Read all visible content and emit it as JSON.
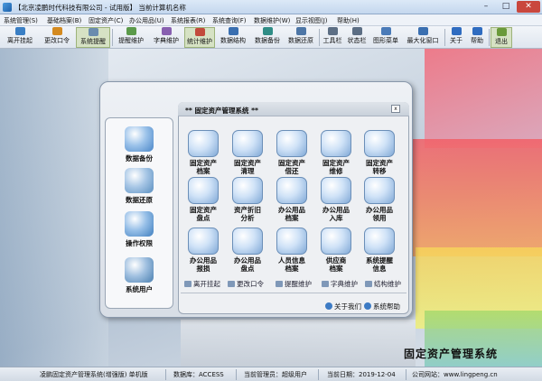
{
  "window": {
    "title": "【北京凌鹏时代科技有限公司 - 试用版】    当前计算机名称",
    "minimize": "–",
    "maximize": "□",
    "close": "✕"
  },
  "menu": [
    "系统管理(S)",
    "基础档案(B)",
    "固定资产(C)",
    "办公用品(U)",
    "系统报表(R)",
    "系统查询(F)",
    "数据维护(W)",
    "显示视图(J)",
    "帮助(H)"
  ],
  "toolbar": [
    {
      "label": "离开挂起",
      "icon": "pause-icon",
      "color": "#3a7fc4"
    },
    {
      "label": "更改口令",
      "icon": "key-icon",
      "color": "#d48a1f"
    },
    {
      "label": "系统提醒",
      "icon": "bell-icon",
      "color": "#6a8cae"
    },
    {
      "label": "提醒维护",
      "icon": "bell-edit-icon",
      "color": "#5b9a4a"
    },
    {
      "label": "字典维护",
      "icon": "book-icon",
      "color": "#8860b0"
    },
    {
      "label": "统计维护",
      "icon": "stats-icon",
      "color": "#c24a3b"
    },
    {
      "label": "数据结构",
      "icon": "database-icon",
      "color": "#3a6fb0"
    },
    {
      "label": "数据备份",
      "icon": "backup-icon",
      "color": "#2f8d86"
    },
    {
      "label": "数据还原",
      "icon": "restore-icon",
      "color": "#4d76a6"
    },
    {
      "label": "工具栏",
      "icon": "toolbar-icon",
      "color": "#5c6e84"
    },
    {
      "label": "状态栏",
      "icon": "statusbar-icon",
      "color": "#5c6e84"
    },
    {
      "label": "图形菜单",
      "icon": "graphic-menu-icon",
      "color": "#4a7bb8"
    },
    {
      "label": "最大化窗口",
      "icon": "maximize-window-icon",
      "color": "#3a6fb0"
    },
    {
      "label": "关于",
      "icon": "info-icon",
      "color": "#2f6cc0"
    },
    {
      "label": "帮助",
      "icon": "help-icon",
      "color": "#2f6cc0"
    },
    {
      "label": "退出",
      "icon": "exit-icon",
      "color": "#6a9a3a"
    }
  ],
  "left_panel": [
    {
      "label": "数据备份",
      "icon": "data-backup-icon",
      "color": "#4a86c8"
    },
    {
      "label": "数据还原",
      "icon": "data-restore-icon",
      "color": "#5a8fc0"
    },
    {
      "label": "操作权限",
      "icon": "folder-permission-icon",
      "color": "#3f7fbf"
    },
    {
      "label": "系统用户",
      "icon": "system-user-icon",
      "color": "#4a7fb0"
    }
  ],
  "panel_title": "** 固定资产管理系统 **",
  "panel_close": "x",
  "functions": [
    {
      "label": "固定资产\n档案",
      "icon": "asset-file-icon"
    },
    {
      "label": "固定资产\n清理",
      "icon": "asset-clean-icon"
    },
    {
      "label": "固定资产\n借还",
      "icon": "asset-borrow-icon"
    },
    {
      "label": "固定资产\n维修",
      "icon": "asset-repair-icon"
    },
    {
      "label": "固定资产\n转移",
      "icon": "asset-transfer-icon"
    },
    {
      "label": "固定资产\n盘点",
      "icon": "asset-inventory-icon"
    },
    {
      "label": "资产折旧\n分析",
      "icon": "depreciation-icon"
    },
    {
      "label": "办公用品\n档案",
      "icon": "supplies-file-icon"
    },
    {
      "label": "办公用品\n入库",
      "icon": "supplies-in-icon"
    },
    {
      "label": "办公用品\n领用",
      "icon": "supplies-receive-icon"
    },
    {
      "label": "办公用品\n报损",
      "icon": "supplies-loss-icon"
    },
    {
      "label": "办公用品\n盘点",
      "icon": "supplies-inventory-icon"
    },
    {
      "label": "人员信息\n档案",
      "icon": "personnel-icon"
    },
    {
      "label": "供应商\n档案",
      "icon": "supplier-icon"
    },
    {
      "label": "系统提醒\n信息",
      "icon": "reminder-info-icon"
    }
  ],
  "quick_links": [
    "离开挂起",
    "更改口令",
    "提醒维护",
    "字典维护",
    "结构维护"
  ],
  "footer_links": [
    "关于我们",
    "系统帮助"
  ],
  "brand": "固定资产管理系统",
  "status": [
    "凌鹏固定资产管理系统(增强版) 单机版",
    "数据库：ACCESS",
    "当前管理员：超级用户",
    "当前日期：2019-12-04",
    "公司网站：www.lingpeng.cn"
  ]
}
